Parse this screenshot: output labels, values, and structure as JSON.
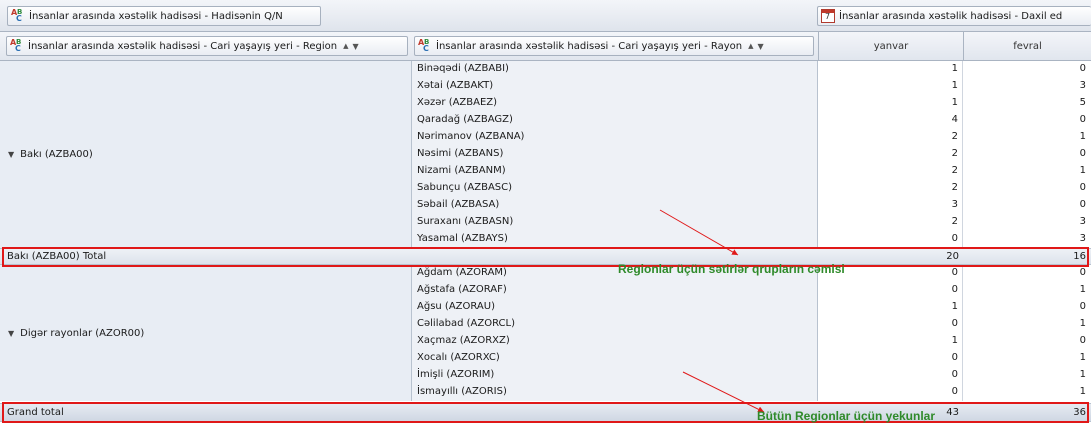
{
  "filters": {
    "top_left": "İnsanlar arasında xəstəlik hadisəsi - Hadisənin Q/N",
    "top_right": "İnsanlar arasında xəstəlik hadisəsi - Daxil ed",
    "region_field": "İnsanlar arasında xəstəlik hadisəsi - Cari yaşayış yeri - Region",
    "rayon_field": "İnsanlar arasında xəstəlik hadisəsi - Cari yaşayış yeri - Rayon",
    "sort_glyph": "▲",
    "filter_glyph": "▼",
    "calendar_num": "7"
  },
  "columns": [
    "yanvar",
    "fevral"
  ],
  "groups": [
    {
      "region": "Bakı (AZBA00)",
      "rows": [
        {
          "name": "Binəqədi (AZBABI)",
          "jan": "1",
          "feb": "0"
        },
        {
          "name": "Xətai (AZBAKT)",
          "jan": "1",
          "feb": "3"
        },
        {
          "name": "Xəzər (AZBAEZ)",
          "jan": "1",
          "feb": "5"
        },
        {
          "name": "Qaradağ (AZBAGZ)",
          "jan": "4",
          "feb": "0"
        },
        {
          "name": "Nərimanov (AZBANA)",
          "jan": "2",
          "feb": "1"
        },
        {
          "name": "Nəsimi (AZBANS)",
          "jan": "2",
          "feb": "0"
        },
        {
          "name": "Nizami (AZBANM)",
          "jan": "2",
          "feb": "1"
        },
        {
          "name": "Sabunçu (AZBASC)",
          "jan": "2",
          "feb": "0"
        },
        {
          "name": "Səbail (AZBASA)",
          "jan": "3",
          "feb": "0"
        },
        {
          "name": "Suraxanı (AZBASN)",
          "jan": "2",
          "feb": "3"
        },
        {
          "name": "Yasamal (AZBAYS)",
          "jan": "0",
          "feb": "3"
        }
      ],
      "total_label": "Bakı (AZBA00) Total",
      "total_jan": "20",
      "total_feb": "16"
    },
    {
      "region": "Digər rayonlar (AZOR00)",
      "rows": [
        {
          "name": "Ağdam (AZORAM)",
          "jan": "0",
          "feb": "0"
        },
        {
          "name": "Ağstafa (AZORAF)",
          "jan": "0",
          "feb": "1"
        },
        {
          "name": "Ağsu (AZORAU)",
          "jan": "1",
          "feb": "0"
        },
        {
          "name": "Cəlilabad (AZORCL)",
          "jan": "0",
          "feb": "1"
        },
        {
          "name": "Xaçmaz (AZORXZ)",
          "jan": "1",
          "feb": "0"
        },
        {
          "name": "Xocalı (AZORXC)",
          "jan": "0",
          "feb": "1"
        },
        {
          "name": "İmişli (AZORIM)",
          "jan": "0",
          "feb": "1"
        },
        {
          "name": "İsmayıllı (AZORIS)",
          "jan": "0",
          "feb": "1"
        }
      ]
    }
  ],
  "grand_total": {
    "label": "Grand total",
    "jan": "43",
    "feb": "36"
  },
  "annotations": {
    "group_sum": "Regionlar üçün sətirlər qrupların cəmisi",
    "all_regions": "Bütün Regionlar üçün yekunlar"
  },
  "colors": {
    "highlight": "#e01818",
    "annotation": "#2f8a2a"
  }
}
